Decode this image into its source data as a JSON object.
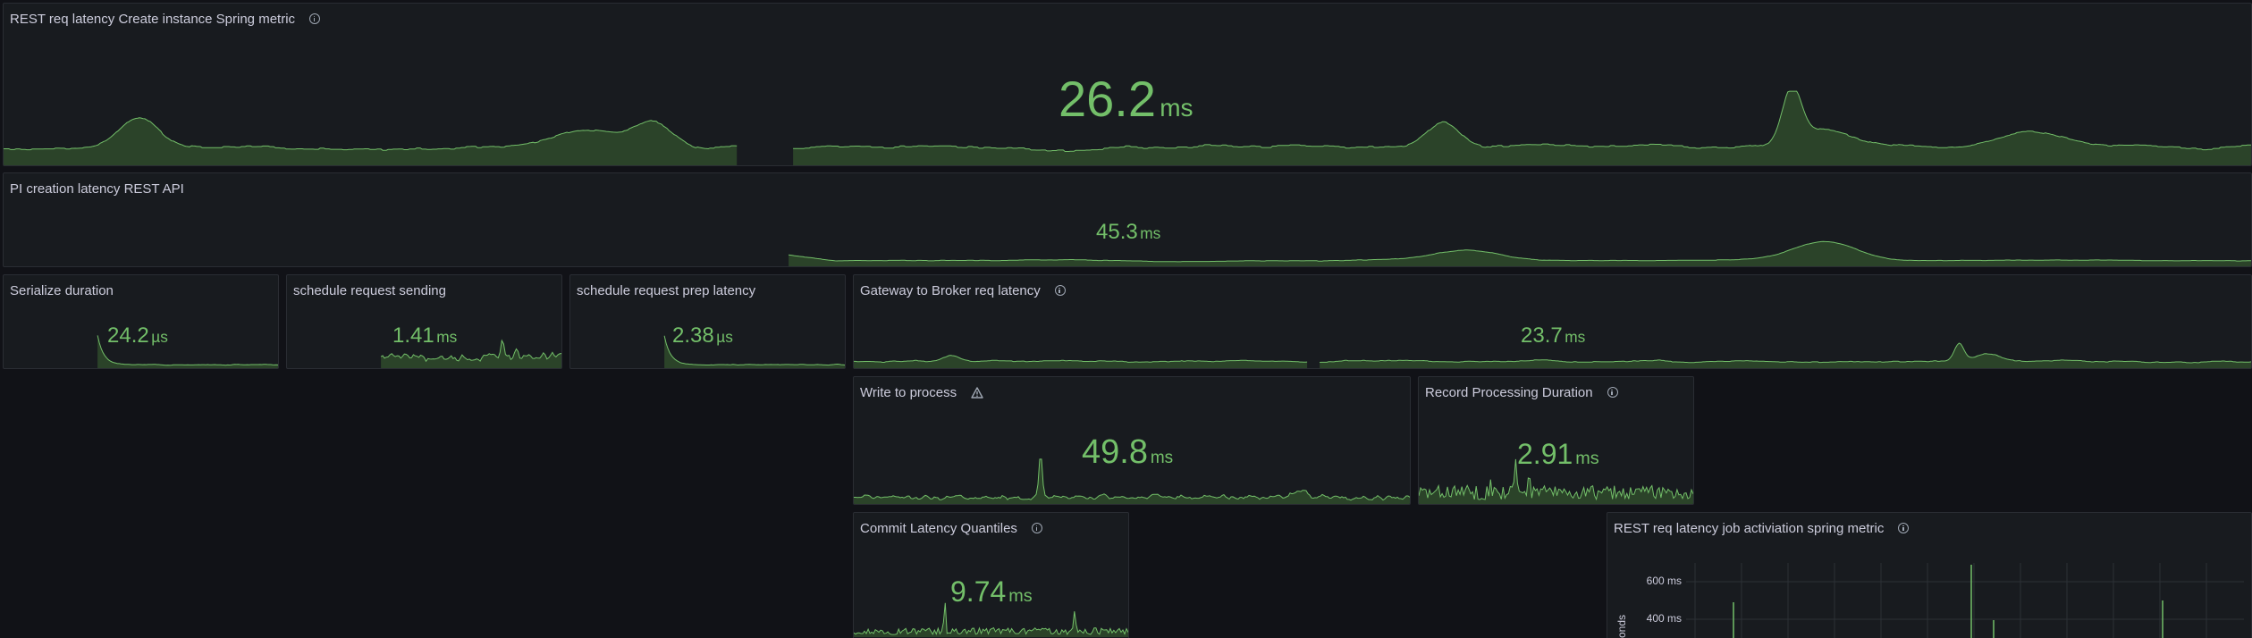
{
  "colors": {
    "background": "#111217",
    "panel": "#181b1f",
    "panel_border": "#2a2d33",
    "stat_green": "#73bf69",
    "spark_fill": "#2f4a2b",
    "title_text": "#ccccdc"
  },
  "panels": [
    {
      "id": "rest-req-latency-create-instance",
      "title": "REST req latency Create instance Spring metric",
      "icon": "info-icon",
      "value": "26.2",
      "unit": "ms"
    },
    {
      "id": "pi-creation-latency",
      "title": "PI creation latency REST API",
      "icon": null,
      "value": "45.3",
      "unit": "ms"
    },
    {
      "id": "serialize-duration",
      "title": "Serialize duration",
      "icon": null,
      "value": "24.2",
      "unit": "µs"
    },
    {
      "id": "schedule-request-sending",
      "title": "schedule request sending",
      "icon": null,
      "value": "1.41",
      "unit": "ms"
    },
    {
      "id": "schedule-request-prep-latency",
      "title": "schedule request prep latency",
      "icon": null,
      "value": "2.38",
      "unit": "µs"
    },
    {
      "id": "gateway-to-broker",
      "title": "Gateway to Broker req latency",
      "icon": "info-icon",
      "value": "23.7",
      "unit": "ms"
    },
    {
      "id": "write-to-process",
      "title": "Write to process",
      "icon": "warning-icon",
      "value": "49.8",
      "unit": "ms"
    },
    {
      "id": "record-processing-duration",
      "title": "Record Processing Duration",
      "icon": "info-icon",
      "value": "2.91",
      "unit": "ms"
    },
    {
      "id": "commit-latency-quantiles",
      "title": "Commit Latency Quantiles",
      "icon": "info-icon",
      "value": "9.74",
      "unit": "ms"
    },
    {
      "id": "rest-req-latency-job-activation",
      "title": "REST req latency job activiation spring metric",
      "icon": "info-icon",
      "y_ticks": [
        "600 ms",
        "400 ms"
      ],
      "y_axis_label": "conds"
    }
  ]
}
